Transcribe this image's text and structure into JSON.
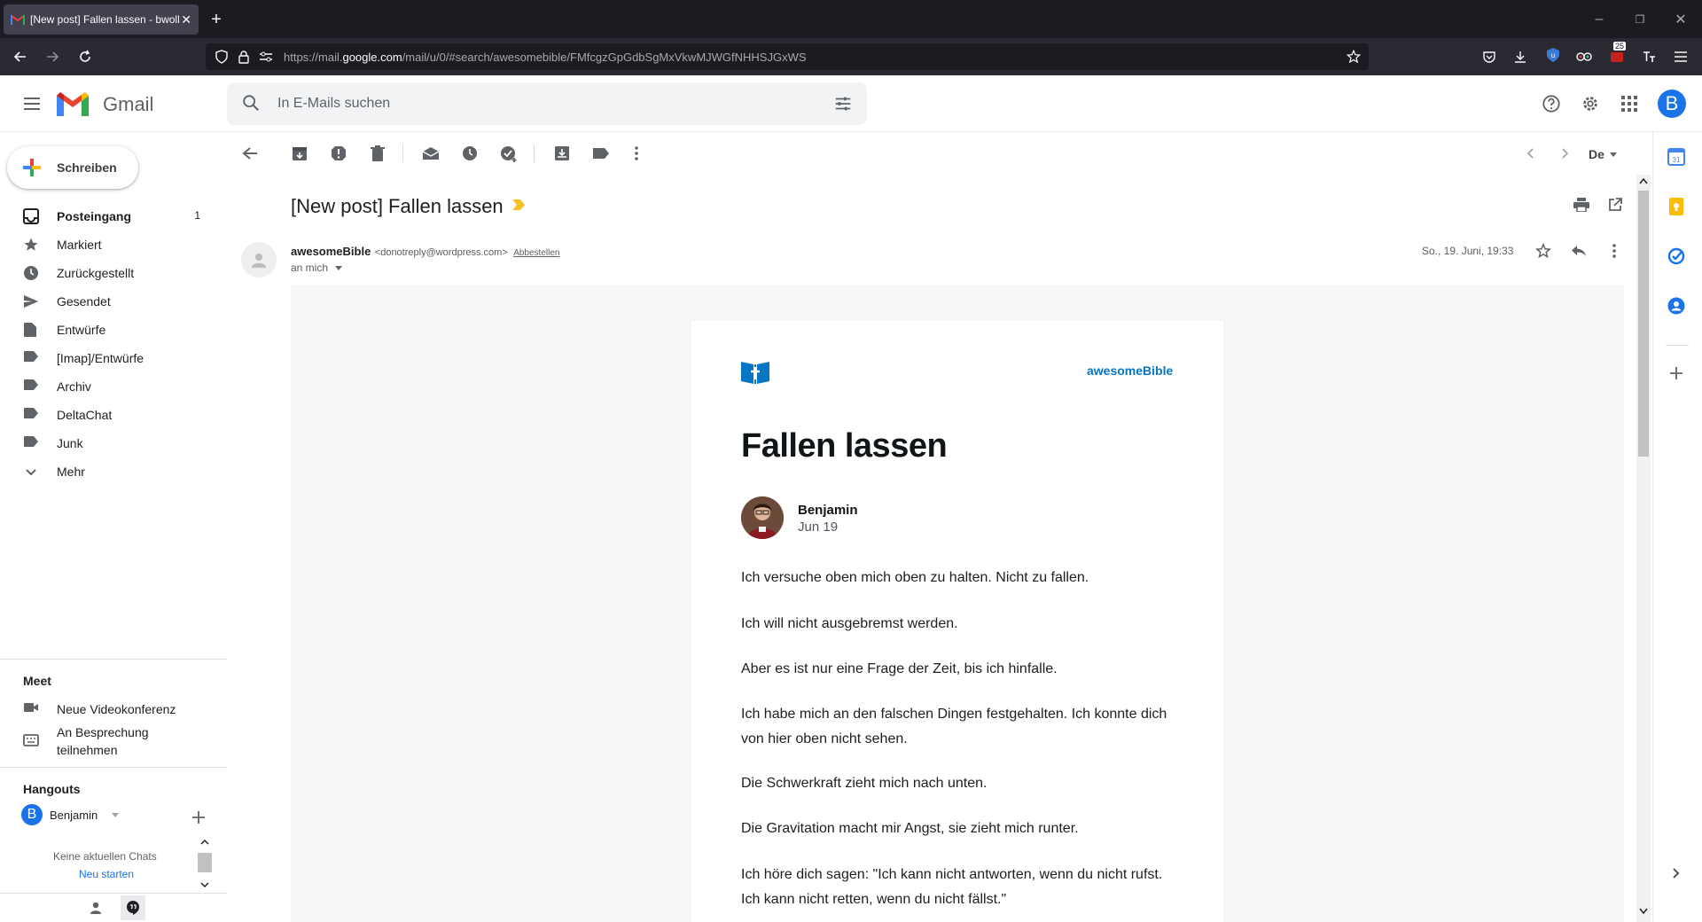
{
  "browser": {
    "tab_title": "[New post] Fallen lassen - bwoll",
    "url_prefix": "https://mail.",
    "url_domain": "google.com",
    "url_rest": "/mail/u/0/#search/awesomebible/FMfcgzGpGdbSgMxVkwMJWGfNHHSJGxWS",
    "badge_count": "25"
  },
  "gmail": {
    "app_name": "Gmail",
    "search_placeholder": "In E-Mails suchen",
    "avatar_letter": "B"
  },
  "sidebar": {
    "compose_label": "Schreiben",
    "items": [
      {
        "label": "Posteingang",
        "count": "1",
        "icon": "inbox-icon"
      },
      {
        "label": "Markiert",
        "icon": "star-icon"
      },
      {
        "label": "Zurückgestellt",
        "icon": "clock-icon"
      },
      {
        "label": "Gesendet",
        "icon": "send-icon"
      },
      {
        "label": "Entwürfe",
        "icon": "draft-icon"
      },
      {
        "label": "[Imap]/Entwürfe",
        "icon": "label-icon"
      },
      {
        "label": "Archiv",
        "icon": "label-icon"
      },
      {
        "label": "DeltaChat",
        "icon": "label-icon"
      },
      {
        "label": "Junk",
        "icon": "label-icon"
      },
      {
        "label": "Mehr",
        "icon": "chevron-down-icon"
      }
    ],
    "meet": {
      "title": "Meet",
      "new_meeting": "Neue Videokonferenz",
      "join_line1": "An Besprechung",
      "join_line2": "teilnehmen"
    },
    "hangouts": {
      "title": "Hangouts",
      "user": "Benjamin",
      "no_chats": "Keine aktuellen Chats",
      "start_new": "Neu starten"
    }
  },
  "toolbar": {
    "lang": "De"
  },
  "message": {
    "subject": "[New post] Fallen lassen",
    "sender_name": "awesomeBible",
    "sender_email": "<donotreply@wordpress.com>",
    "unsubscribe": "Abbestellen",
    "to": "an mich",
    "date": "So., 19. Juni, 19:33"
  },
  "post": {
    "site_name": "awesomeBible",
    "title": "Fallen lassen",
    "author": "Benjamin",
    "date": "Jun 19",
    "paragraphs": [
      "Ich versuche oben mich oben zu halten. Nicht zu fallen.",
      "Ich will nicht ausgebremst werden.",
      "Aber es ist nur eine Frage der Zeit, bis ich hinfalle.",
      "Ich habe mich an den falschen Dingen festgehalten. Ich konnte dich von hier oben nicht sehen.",
      "Die Schwerkraft zieht mich nach unten.",
      "Die Gravitation macht mir Angst, sie zieht mich runter.",
      "Ich höre dich sagen: \"Ich kann nicht antworten, wenn du nicht rufst. Ich kann nicht retten, wenn du nicht fällst.\""
    ]
  },
  "colors": {
    "accent_blue": "#1a73e8",
    "brand_blue": "#0675c4",
    "label_yellow": "#f6c026"
  }
}
